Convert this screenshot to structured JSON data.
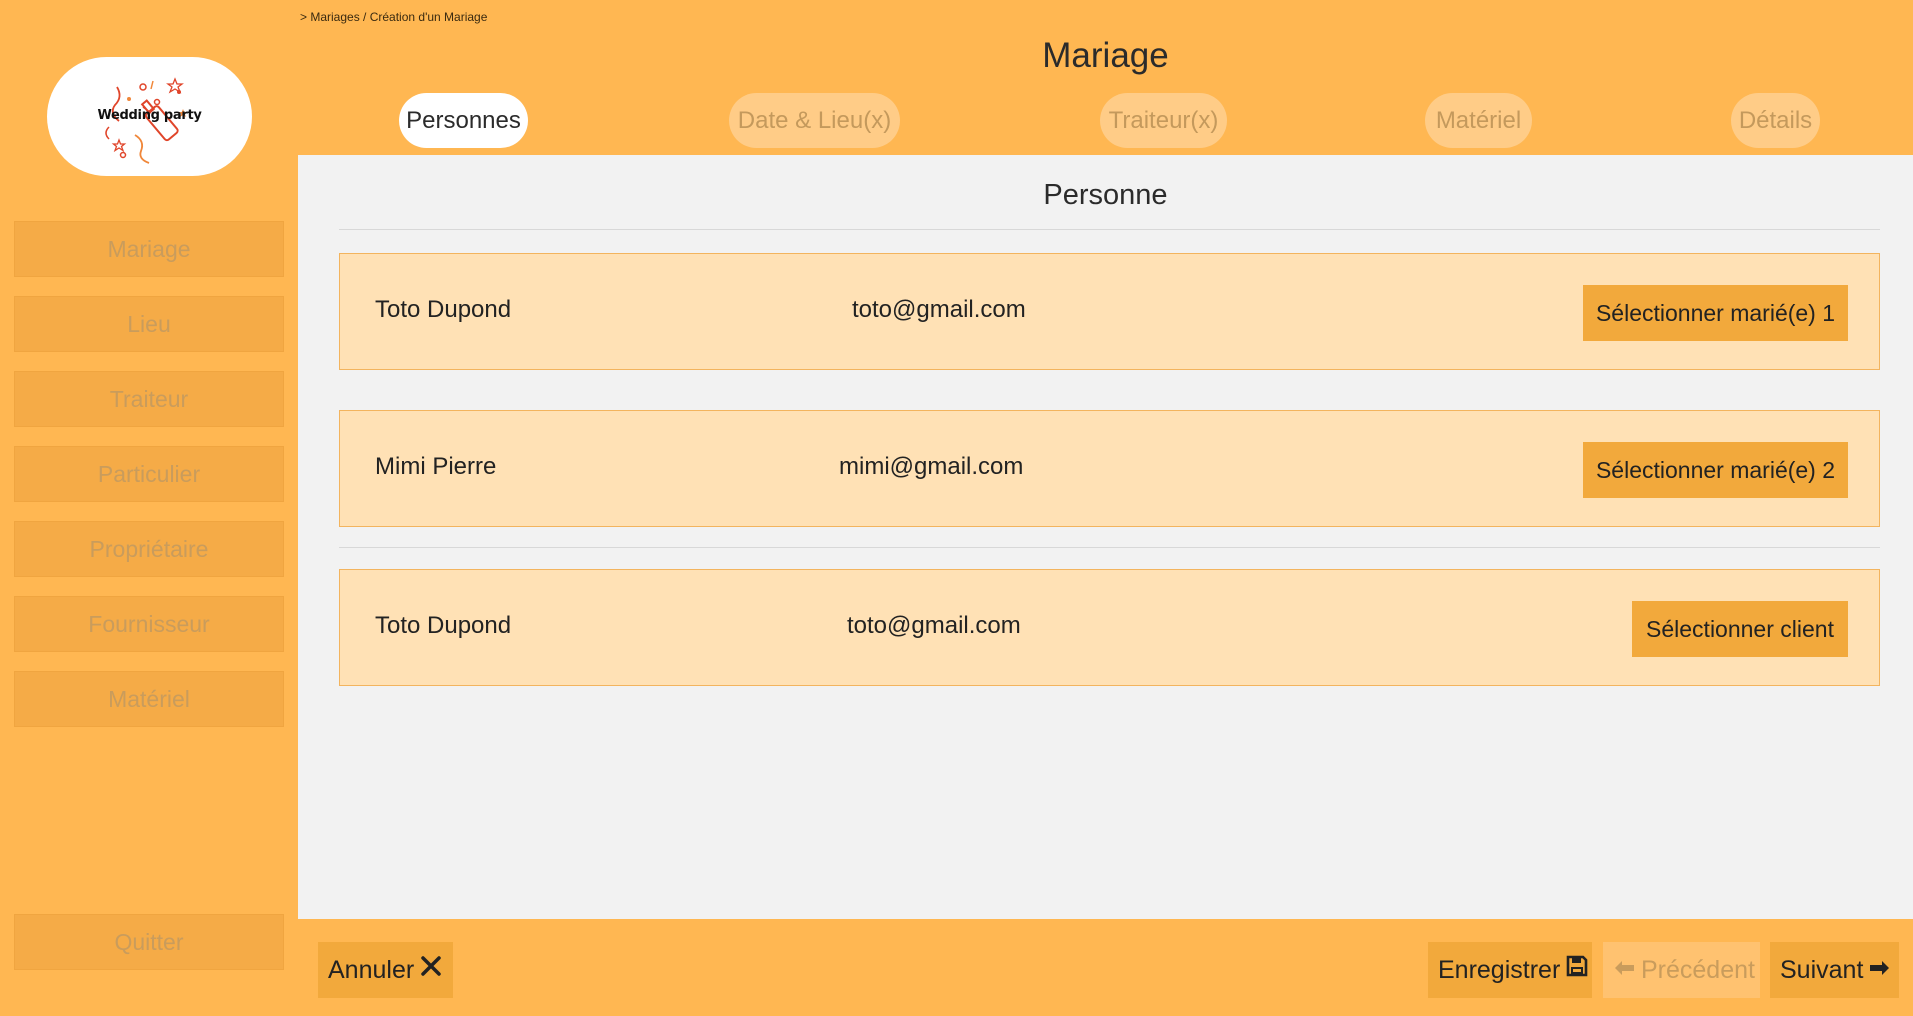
{
  "breadcrumb": "> Mariages / Création d'un Mariage",
  "logo": {
    "text": "Wedding party"
  },
  "sidebar": {
    "items": [
      {
        "label": "Mariage"
      },
      {
        "label": "Lieu"
      },
      {
        "label": "Traiteur"
      },
      {
        "label": "Particulier"
      },
      {
        "label": "Propriétaire"
      },
      {
        "label": "Fournisseur"
      },
      {
        "label": "Matériel"
      }
    ],
    "quit_label": "Quitter"
  },
  "header": {
    "title": "Mariage",
    "tabs": [
      {
        "label": "Personnes",
        "active": true
      },
      {
        "label": "Date & Lieu(x)",
        "active": false
      },
      {
        "label": "Traiteur(x)",
        "active": false
      },
      {
        "label": "Matériel",
        "active": false
      },
      {
        "label": "Détails",
        "active": false
      }
    ]
  },
  "main": {
    "section_title": "Personne",
    "persons": [
      {
        "name": "Toto Dupond",
        "email": "toto@gmail.com",
        "button": "Sélectionner marié(e) 1"
      },
      {
        "name": "Mimi Pierre",
        "email": "mimi@gmail.com",
        "button": "Sélectionner marié(e) 2"
      },
      {
        "name": "Toto Dupond",
        "email": "toto@gmail.com",
        "button": "Sélectionner client"
      }
    ]
  },
  "footer": {
    "cancel_label": "Annuler",
    "save_label": "Enregistrer",
    "previous_label": "Précédent",
    "next_label": "Suivant"
  },
  "colors": {
    "background": "#ffb752",
    "panel": "#f2f2f2",
    "card": "#ffe1b5",
    "button": "#f2a93c"
  }
}
